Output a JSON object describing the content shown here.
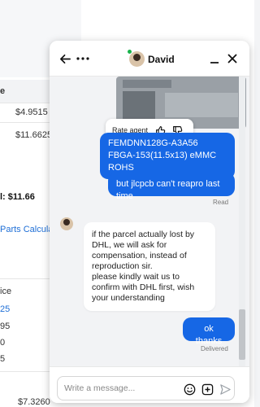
{
  "background": {
    "col_header": "e",
    "prices": [
      "$4.9515",
      "$11.6625"
    ],
    "total": "l: $11.66",
    "parts_link": "Parts Calculato",
    "price_header": "ice",
    "list_values": [
      "25",
      "95",
      "0",
      "5"
    ],
    "bottom_price": "$7.3260"
  },
  "chat": {
    "agent_name": "David",
    "rate_label": "Rate agent",
    "messages": {
      "out1_line1": "FEMDNN128G-A3A56",
      "out1_line2": "FBGA-153(11.5x13) eMMC ROHS",
      "out2": "but jlcpcb can't reapro last time",
      "out2_status": "Read",
      "in1": "if the parcel actually lost by DHL, we will ask for compensation, instead of reproduction sir.\nplease kindly wait us to confirm with DHL first, wish your understanding",
      "out3": "ok thanks",
      "out3_status": "Delivered"
    },
    "input": {
      "placeholder": "Write a message...",
      "value": ""
    }
  }
}
